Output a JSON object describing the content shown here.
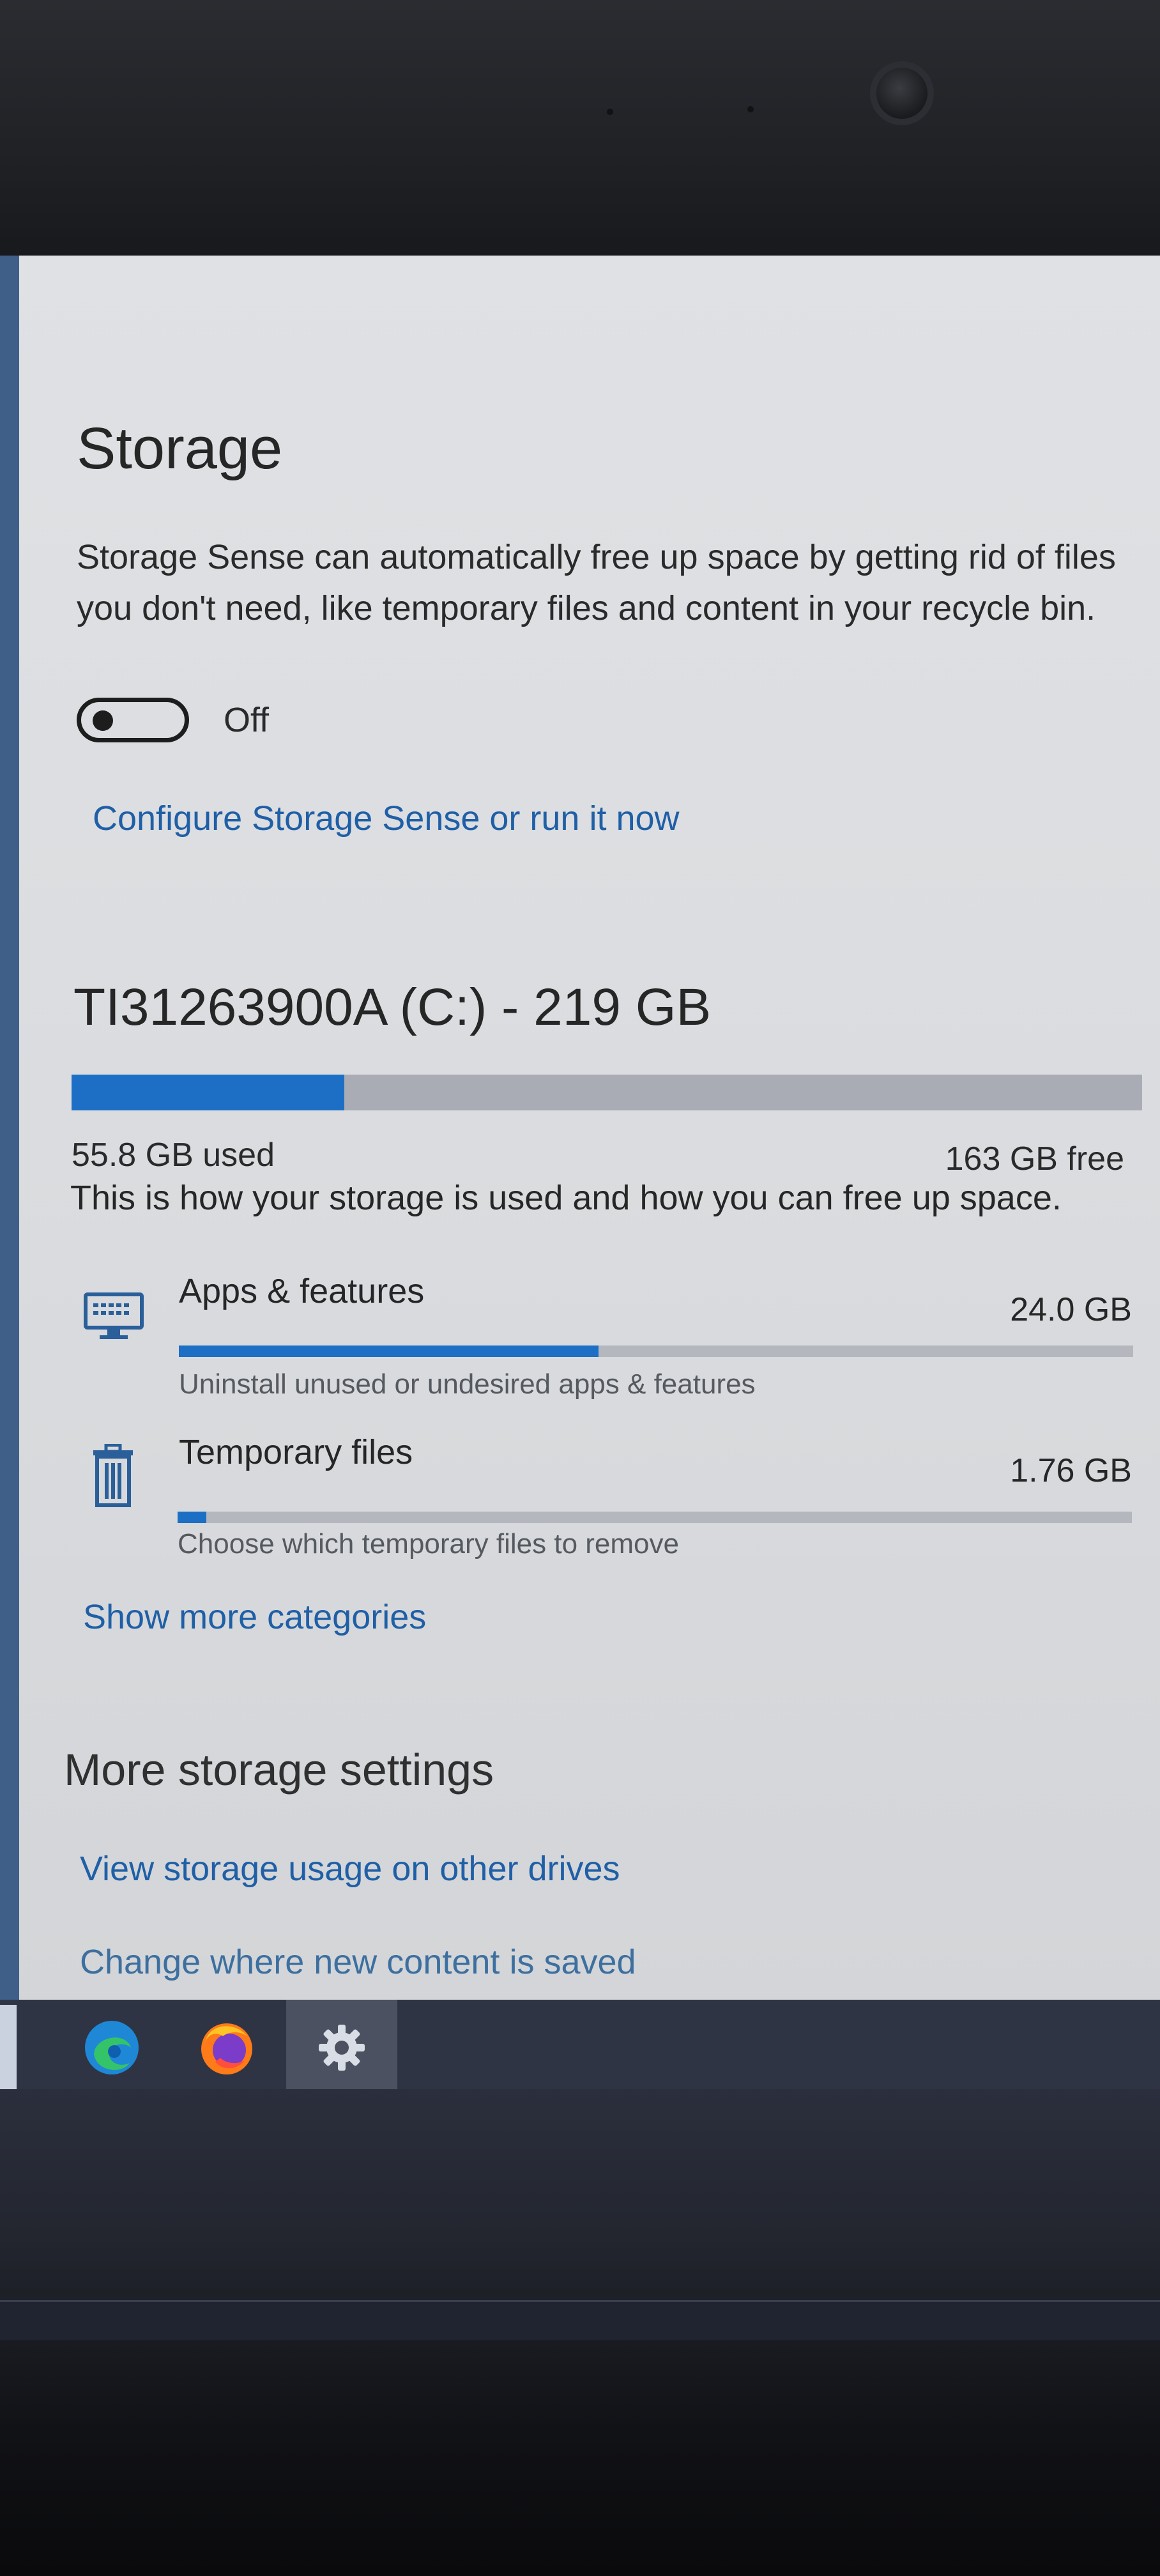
{
  "storage": {
    "title": "Storage",
    "description": "Storage Sense can automatically free up space by getting rid of files you don't need, like temporary files and content in your recycle bin.",
    "toggle_state": "Off",
    "configure_link": "Configure Storage Sense or run it now"
  },
  "drive": {
    "title": "TI31263900A (C:) - 219 GB",
    "used_label": "55.8 GB used",
    "free_label": "163 GB free",
    "used_fraction": 0.255,
    "usage_text": "This is how your storage is used and how you can free up space."
  },
  "categories": [
    {
      "name": "Apps & features",
      "size": "24.0 GB",
      "hint": "Uninstall unused or undesired apps & features",
      "fraction": 0.44,
      "icon": "monitor-icon"
    },
    {
      "name": "Temporary files",
      "size": "1.76 GB",
      "hint": "Choose which temporary files to remove",
      "fraction": 0.03,
      "icon": "trash-icon"
    }
  ],
  "show_more_link": "Show more categories",
  "more_settings": {
    "title": "More storage settings",
    "links": [
      "View storage usage on other drives",
      "Change where new content is saved"
    ]
  },
  "taskbar": {
    "icons": [
      "edge-icon",
      "firefox-icon",
      "settings-gear-icon"
    ],
    "active": "settings-gear-icon"
  },
  "colors": {
    "accent": "#1c6fc4",
    "link": "#1f5fa6",
    "taskbar": "#2f3444"
  }
}
